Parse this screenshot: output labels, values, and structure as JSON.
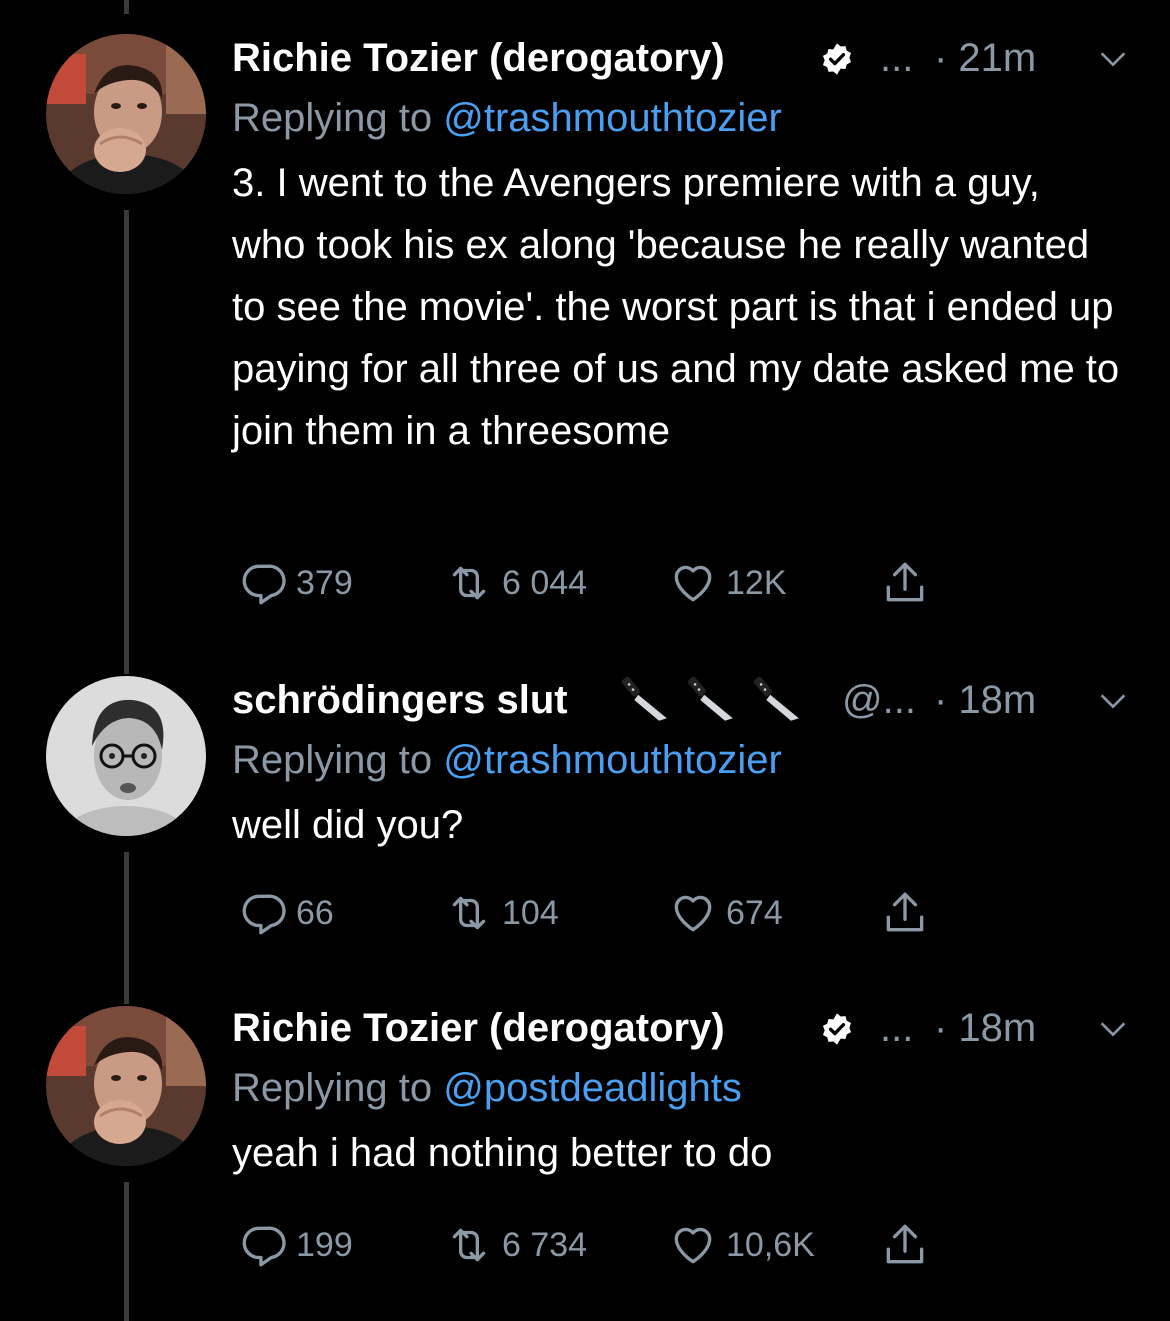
{
  "tweets": [
    {
      "name": "Richie Tozier (derogatory)",
      "verified": true,
      "handle_more": "...",
      "time": "· 21m",
      "reply_prefix": "Replying to",
      "reply_to": "@trashmouthtozier",
      "text": "3. I went to the Avengers premiere with a guy, who took his ex along 'because he really wanted to see the movie'. the worst part is that i ended up paying for all three of us and my date asked me to join them in a threesome",
      "replies": "379",
      "retweets": "6 044",
      "likes": "12K"
    },
    {
      "name": "schrödingers slut",
      "verified": false,
      "handle_more": "@...",
      "time": "· 18m",
      "reply_prefix": "Replying to",
      "reply_to": "@trashmouthtozier",
      "text": "well did you?",
      "replies": "66",
      "retweets": "104",
      "likes": "674"
    },
    {
      "name": "Richie Tozier (derogatory)",
      "verified": true,
      "handle_more": "...",
      "time": "· 18m",
      "reply_prefix": "Replying to",
      "reply_to": "@postdeadlights",
      "text": "yeah i had nothing better to do",
      "replies": "199",
      "retweets": "6 734",
      "likes": "10,6K"
    }
  ],
  "colors": {
    "background": "#000000",
    "secondary_text": "#8b98a5",
    "mention": "#4a9ff0",
    "thread_line": "#3a3a3a"
  },
  "icons": [
    "verified-badge-icon",
    "knife-icon",
    "chevron-down-icon",
    "reply-icon",
    "retweet-icon",
    "like-icon",
    "share-icon"
  ]
}
